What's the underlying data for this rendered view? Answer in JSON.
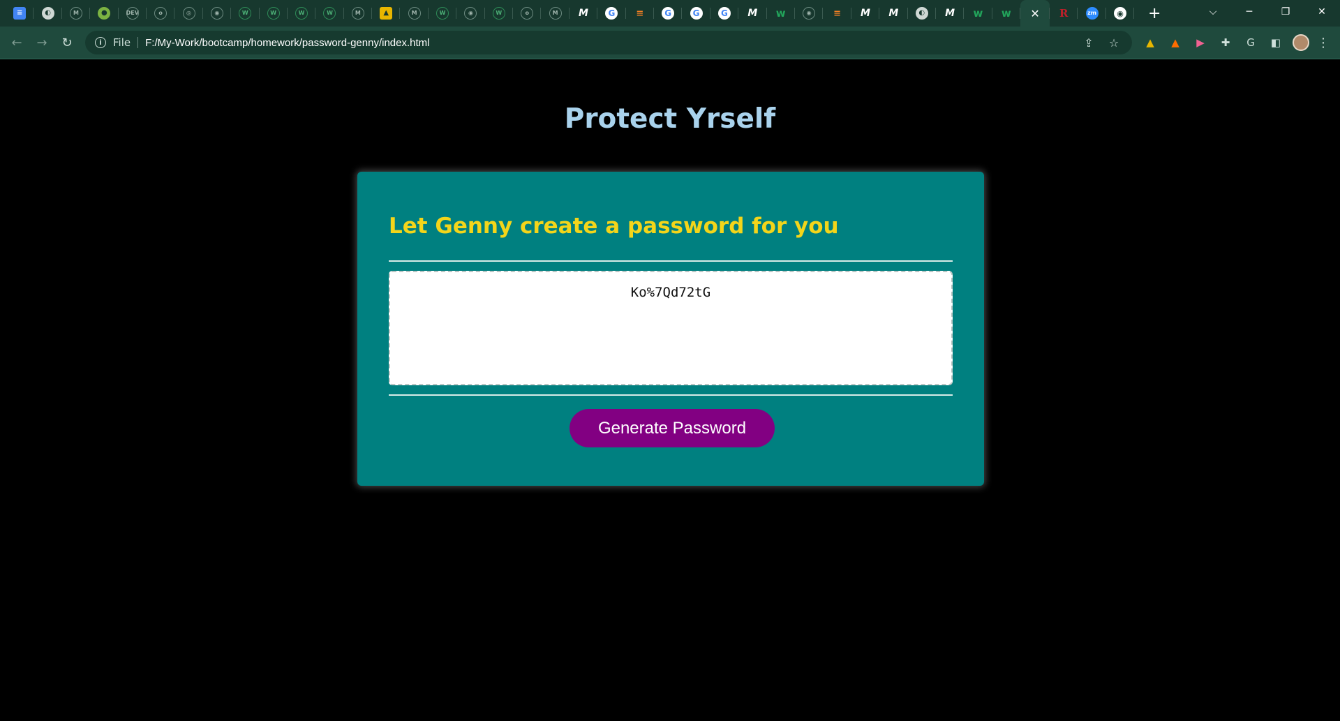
{
  "browser": {
    "tabs": [
      {
        "icon": "docs-icon",
        "glyph": "≡"
      },
      {
        "icon": "globe-icon",
        "glyph": "◐"
      },
      {
        "icon": "medium-circle-icon",
        "glyph": "M"
      },
      {
        "icon": "leaf-icon",
        "glyph": "●"
      },
      {
        "icon": "dev-icon",
        "glyph": "DEV"
      },
      {
        "icon": "ring-icon",
        "glyph": "o"
      },
      {
        "icon": "openai-icon",
        "glyph": "◎"
      },
      {
        "icon": "openai-icon",
        "glyph": "◉"
      },
      {
        "icon": "w-circle-icon",
        "glyph": "W"
      },
      {
        "icon": "w-circle-icon",
        "glyph": "W"
      },
      {
        "icon": "w-circle-icon",
        "glyph": "W"
      },
      {
        "icon": "w-circle-icon",
        "glyph": "W"
      },
      {
        "icon": "medium-circle-icon",
        "glyph": "M"
      },
      {
        "icon": "lock-icon",
        "glyph": "▲"
      },
      {
        "icon": "medium-circle-icon",
        "glyph": "M"
      },
      {
        "icon": "w-circle-icon",
        "glyph": "W"
      },
      {
        "icon": "openai-icon",
        "glyph": "◉"
      },
      {
        "icon": "w-circle-icon",
        "glyph": "W"
      },
      {
        "icon": "ring-icon",
        "glyph": "o"
      },
      {
        "icon": "medium-circle-icon",
        "glyph": "M"
      },
      {
        "icon": "medium-icon",
        "glyph": "M"
      },
      {
        "icon": "google-icon",
        "glyph": "G"
      },
      {
        "icon": "stackoverflow-icon",
        "glyph": "≡"
      },
      {
        "icon": "google-icon",
        "glyph": "G"
      },
      {
        "icon": "google-icon",
        "glyph": "G"
      },
      {
        "icon": "google-icon",
        "glyph": "G"
      },
      {
        "icon": "medium-icon",
        "glyph": "M"
      },
      {
        "icon": "w-icon",
        "glyph": "w"
      },
      {
        "icon": "openai-icon",
        "glyph": "◉"
      },
      {
        "icon": "stackoverflow-icon",
        "glyph": "≡"
      },
      {
        "icon": "medium-icon",
        "glyph": "M"
      },
      {
        "icon": "medium-icon",
        "glyph": "M"
      },
      {
        "icon": "globe-icon",
        "glyph": "◐"
      },
      {
        "icon": "medium-icon",
        "glyph": "M"
      },
      {
        "icon": "w-icon",
        "glyph": "w"
      },
      {
        "icon": "w-icon",
        "glyph": "w"
      }
    ],
    "active_tab_close": "✕",
    "trailing_tabs": [
      {
        "icon": "r-icon",
        "glyph": "R"
      },
      {
        "icon": "zoom-icon",
        "glyph": "zm"
      },
      {
        "icon": "github-icon",
        "glyph": "◉"
      }
    ],
    "new_tab": "+",
    "window_controls": {
      "tab_search": "⌵",
      "minimize": "─",
      "restore": "❐",
      "close": "✕"
    },
    "nav": {
      "back": "←",
      "forward": "→",
      "reload": "↻"
    },
    "address": {
      "info": "i",
      "scheme": "File",
      "url": "F:/My-Work/bootcamp/homework/password-genny/index.html"
    },
    "omni_actions": {
      "share": "⇪",
      "bookmark": "☆"
    },
    "extensions": {
      "amazon": "▲",
      "orange": "▲",
      "pink": "▶",
      "puzzle": "✚",
      "grammarly": "G",
      "sidepanel": "◧"
    },
    "menu": "⋮"
  },
  "page": {
    "title": "Protect Yrself",
    "card_header": "Let Genny create a password for you",
    "password": "Ko%7Qd72tG",
    "generate_label": "Generate Password"
  },
  "colors": {
    "background": "#000000",
    "title": "#a9d2ec",
    "card": "#008080",
    "card_header": "#f3d51a",
    "button": "#820082"
  }
}
